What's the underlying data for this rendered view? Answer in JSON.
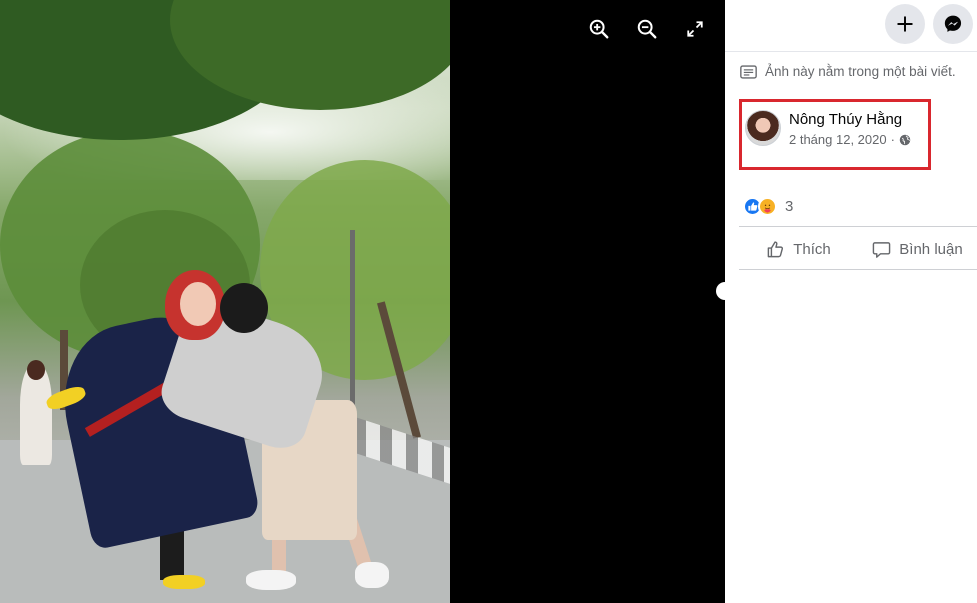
{
  "viewer": {
    "controls": [
      {
        "name": "zoom-in-icon"
      },
      {
        "name": "zoom-out-icon"
      },
      {
        "name": "fullscreen-icon"
      }
    ]
  },
  "panel": {
    "top_buttons": {
      "create": "plus-icon",
      "messenger": "messenger-icon"
    },
    "post_note": "Ảnh này nằm trong một bài viết.",
    "author": {
      "name": "Nông Thúy Hằng",
      "date": "2 tháng 12, 2020",
      "separator": "·",
      "privacy_icon": "globe-icon"
    },
    "reactions": {
      "types": [
        "like",
        "care"
      ],
      "count": "3"
    },
    "actions": {
      "like_label": "Thích",
      "comment_label": "Bình luận"
    }
  },
  "colors": {
    "highlight_box": "#d9272e",
    "like_blue": "#1877f2",
    "muted_text": "#65676b"
  }
}
